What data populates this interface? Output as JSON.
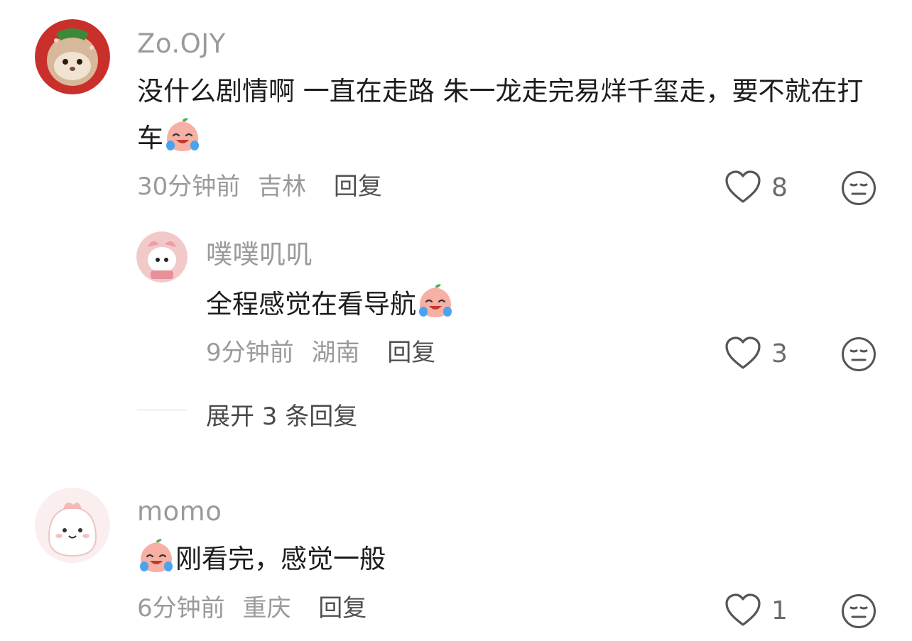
{
  "comments": [
    {
      "username": "Zo.OJY",
      "text": "没什么剧情啊 一直在走路 朱一龙走完易烊千玺走，要不就在打车",
      "emoji": "crying-laugh-peach-emoji",
      "time": "30分钟前",
      "location": "吉林",
      "reply_label": "回复",
      "likes": "8",
      "replies": [
        {
          "username": "噗噗叽叽",
          "text": "全程感觉在看导航",
          "emoji": "crying-laugh-peach-emoji",
          "time": "9分钟前",
          "location": "湖南",
          "reply_label": "回复",
          "likes": "3"
        }
      ],
      "expand_label": "展开 3 条回复"
    },
    {
      "username": "momo",
      "text": "刚看完，感觉一般",
      "emoji": "crying-laugh-peach-emoji",
      "time": "6分钟前",
      "location": "重庆",
      "reply_label": "回复",
      "likes": "1"
    }
  ],
  "icons": {
    "like": "heart-outline-icon",
    "face": "neutral-face-icon"
  },
  "colors": {
    "text": "#1c1c1c",
    "muted": "#9a9a9a",
    "icon": "#555555"
  }
}
